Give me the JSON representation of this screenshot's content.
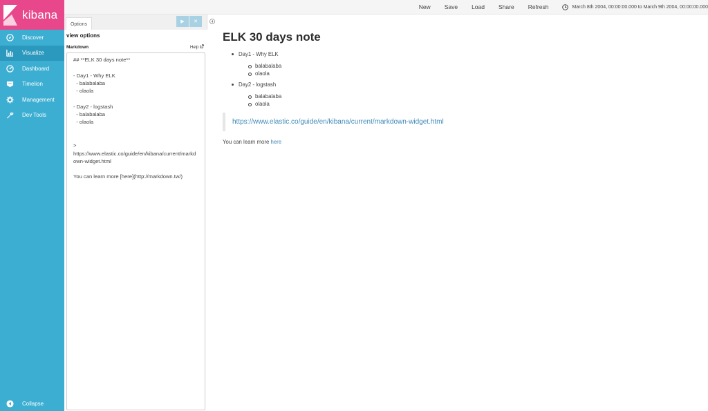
{
  "app": {
    "logo_text": "kibana"
  },
  "sidebar": {
    "items": [
      {
        "label": "Discover",
        "icon": "compass-icon"
      },
      {
        "label": "Visualize",
        "icon": "bar-chart-icon",
        "active": true
      },
      {
        "label": "Dashboard",
        "icon": "dashboard-icon"
      },
      {
        "label": "Timelion",
        "icon": "timelion-icon"
      },
      {
        "label": "Management",
        "icon": "gear-icon"
      },
      {
        "label": "Dev Tools",
        "icon": "wrench-icon"
      }
    ],
    "collapse_label": "Collapse"
  },
  "toolbar": {
    "new_label": "New",
    "save_label": "Save",
    "load_label": "Load",
    "share_label": "Share",
    "refresh_label": "Refresh",
    "time_range": "March 8th 2004, 00:00:00.000 to March 9th 2004, 00:00:00.000"
  },
  "editor": {
    "tab_label": "Options",
    "run_glyph": "▶",
    "discard_glyph": "✕",
    "section_title": "view options",
    "markdown_label": "Markdown",
    "help_label": "Help",
    "markdown_text": "## **ELK 30 days note**\n\n- Day1 - Why ELK\n  - balabalaba\n  - olaola\n\n- Day2 - logstash\n  - balabalaba\n  - olaola\n\n\n>\nhttps://www.elastic.co/guide/en/kibana/current/markdown-widget.html\n\nYou can learn more [here](http://markdown.tw/)"
  },
  "preview": {
    "title": "ELK 30 days note",
    "day1_label": "Day1 - Why ELK",
    "day1_items": [
      "balabalaba",
      "olaola"
    ],
    "day2_label": "Day2 - logstash",
    "day2_items": [
      "balabalaba",
      "olaola"
    ],
    "quote_link": "https://www.elastic.co/guide/en/kibana/current/markdown-widget.html",
    "learn_prefix": "You can learn more ",
    "learn_link_label": "here"
  },
  "colors": {
    "sidebar": "#3caed2",
    "logo_bg": "#e8488b",
    "active_nav": "#2b98bd",
    "link": "#3f8ab8"
  }
}
